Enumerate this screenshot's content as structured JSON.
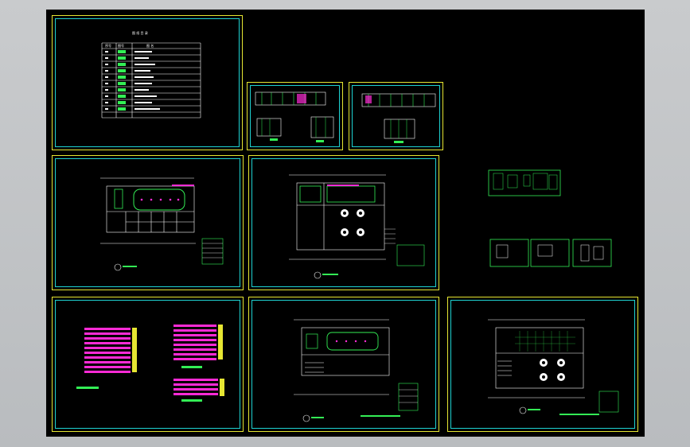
{
  "viewer": {
    "background_color": "#000000",
    "frame_colors": {
      "outer": "#e6e632",
      "inner": "#1ed2d2",
      "wall": "#ffffff",
      "accent": "#ff2bd6",
      "green": "#33ee55"
    }
  },
  "index_sheet": {
    "title": "图 纸 目 录",
    "headers": [
      "序号",
      "图号",
      "图 名"
    ],
    "rows": [
      {
        "no": "1",
        "code": "",
        "name": "平面布置图"
      },
      {
        "no": "2",
        "code": "",
        "name": "天花"
      },
      {
        "no": "3",
        "code": "",
        "name": "地面"
      },
      {
        "no": "4",
        "code": "",
        "name": "立面"
      },
      {
        "no": "5",
        "code": "",
        "name": "立面"
      },
      {
        "no": "6",
        "code": "",
        "name": "立面"
      },
      {
        "no": "7",
        "code": "",
        "name": "立面"
      },
      {
        "no": "8",
        "code": "",
        "name": "大样"
      }
    ]
  }
}
